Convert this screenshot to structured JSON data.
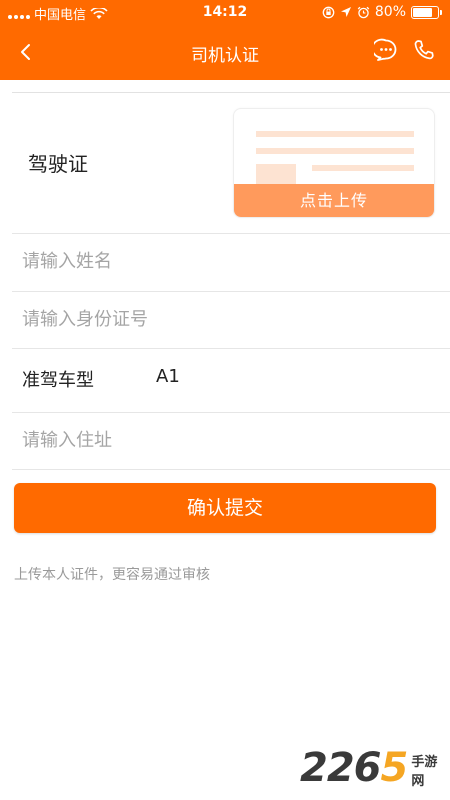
{
  "status_bar": {
    "carrier": "中国电信",
    "time": "14:12",
    "battery_percent": "80%",
    "battery_level": 0.8,
    "icons": [
      "signal-icon",
      "wifi-icon",
      "orientation-lock-icon",
      "location-icon",
      "alarm-icon",
      "battery-icon"
    ]
  },
  "nav": {
    "title": "司机认证",
    "back_icon": "chevron-left-icon",
    "chat_icon": "chat-icon",
    "phone_icon": "phone-icon"
  },
  "license": {
    "label": "驾驶证",
    "upload_label": "点击上传"
  },
  "form": {
    "name_placeholder": "请输入姓名",
    "id_placeholder": "请输入身份证号",
    "license_type_label": "准驾车型",
    "license_type_value": "A1",
    "address_placeholder": "请输入住址"
  },
  "submit": {
    "label": "确认提交"
  },
  "hint": "上传本人证件，更容易通过审核",
  "watermark": {
    "digits_a": "22",
    "digit_b": "6",
    "digit_c": "5",
    "text": "手游网"
  },
  "colors": {
    "accent": "#ff6a00",
    "upload_bar": "#ff9a5c",
    "card_placeholder": "#fde3d2"
  }
}
